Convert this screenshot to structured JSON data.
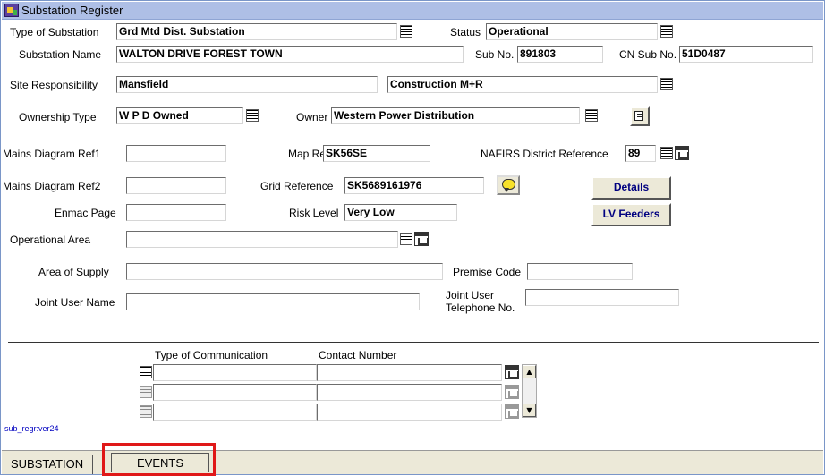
{
  "window": {
    "title": "Substation Register",
    "icon": "app-icon"
  },
  "form": {
    "type_of_substation": {
      "label": "Type of Substation",
      "value": "Grd Mtd Dist. Substation"
    },
    "status": {
      "label": "Status",
      "value": "Operational"
    },
    "substation_name": {
      "label": "Substation Name",
      "value": "WALTON DRIVE FOREST TOWN"
    },
    "sub_no": {
      "label": "Sub No.",
      "value": "891803"
    },
    "cn_sub_no": {
      "label": "CN Sub No.",
      "value": "51D0487"
    },
    "site_responsibility": {
      "label": "Site Responsibility",
      "value": "Mansfield",
      "value2": "Construction M+R"
    },
    "ownership_type": {
      "label": "Ownership Type",
      "value": "W P D Owned"
    },
    "owner": {
      "label": "Owner",
      "value": "Western Power Distribution"
    },
    "mains_diagram_ref1": {
      "label": "Mains Diagram Ref1",
      "value": ""
    },
    "map_ref": {
      "label": "Map Ref",
      "value": "SK56SE"
    },
    "nafirs": {
      "label": "NAFIRS District Reference",
      "value": "89"
    },
    "mains_diagram_ref2": {
      "label": "Mains Diagram Ref2",
      "value": ""
    },
    "grid_reference": {
      "label": "Grid Reference",
      "value": "SK5689161976"
    },
    "enmac_page": {
      "label": "Enmac Page",
      "value": ""
    },
    "risk_level": {
      "label": "Risk Level",
      "value": "Very Low"
    },
    "operational_area": {
      "label": "Operational Area",
      "value": ""
    },
    "area_of_supply": {
      "label": "Area of Supply",
      "value": ""
    },
    "premise_code": {
      "label": "Premise Code",
      "value": ""
    },
    "joint_user_name": {
      "label": "Joint User Name",
      "value": ""
    },
    "joint_user_tel": {
      "label_line1": "Joint User",
      "label_line2": "Telephone No.",
      "value": ""
    }
  },
  "buttons": {
    "details": "Details",
    "lv_feeders": "LV Feeders"
  },
  "comms_table": {
    "headers": [
      "Type of Communication",
      "Contact Number"
    ],
    "rows": [
      {
        "type": "",
        "number": ""
      },
      {
        "type": "",
        "number": ""
      },
      {
        "type": "",
        "number": ""
      }
    ]
  },
  "version": "sub_regr:ver24",
  "tabs": [
    {
      "label": "SUBSTATION"
    },
    {
      "label": "EVENTS"
    }
  ],
  "colors": {
    "titlebar": "#aebfe6",
    "button_text": "#000080",
    "highlight": "#e01818",
    "version_text": "#0000c0"
  }
}
